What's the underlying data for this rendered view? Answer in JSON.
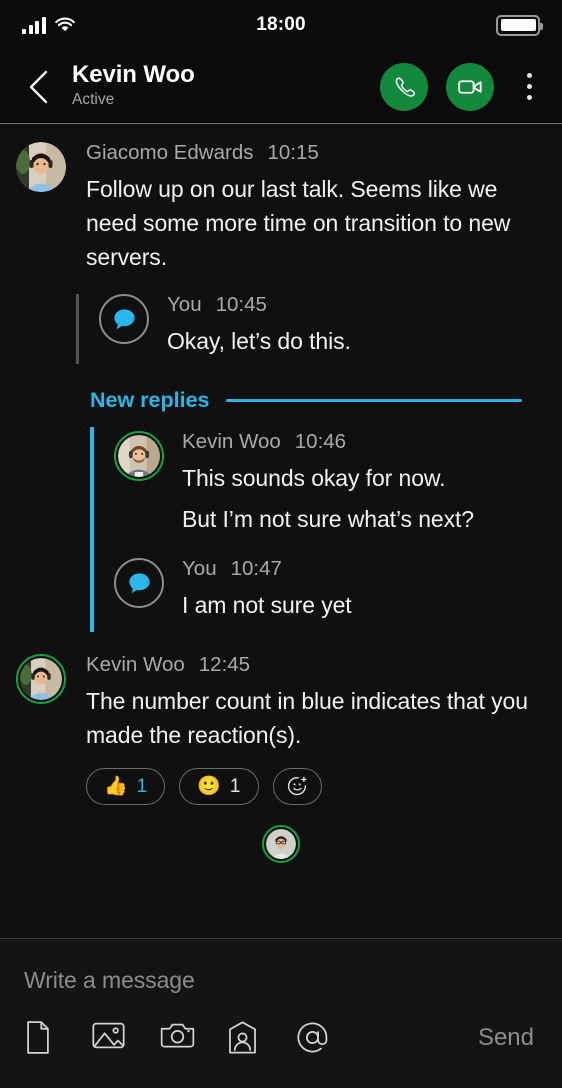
{
  "status_bar": {
    "time": "18:00",
    "signal_icon": "signal-bars-icon",
    "wifi_icon": "wifi-icon",
    "battery_icon": "battery-full-icon"
  },
  "header": {
    "back_icon": "chevron-left-icon",
    "contact_name": "Kevin Woo",
    "presence": "Active",
    "call_icon": "phone-icon",
    "video_icon": "video-camera-icon",
    "menu_icon": "kebab-menu-icon",
    "accent_green": "#12893c"
  },
  "theme": {
    "background": "#101010",
    "accent_cyan": "#29b6e8",
    "online_green": "#13a33f",
    "muted_text": "#a9a9a9",
    "body_text": "#f2f2f2"
  },
  "conversation": {
    "root_message": {
      "author": "Giacomo Edwards",
      "time": "10:15",
      "avatar_name": "avatar-giacomo-edwards",
      "text": "Follow up on our last talk. Seems like we need some more time on transition to new servers."
    },
    "old_reply": {
      "author": "You",
      "time": "10:45",
      "avatar_name": "avatar-you-speech-bubble",
      "text": "Okay, let’s do this."
    },
    "new_replies_divider": {
      "label": "New replies"
    },
    "new_replies": [
      {
        "author": "Kevin Woo",
        "time": "10:46",
        "avatar_name": "avatar-kevin-woo",
        "online": true,
        "lines": [
          "This sounds okay for now.",
          "But I’m not sure what’s next?"
        ]
      },
      {
        "author": "You",
        "time": "10:47",
        "avatar_name": "avatar-you-speech-bubble",
        "online": false,
        "lines": [
          "I am not sure yet"
        ]
      }
    ],
    "last_message": {
      "author": "Kevin Woo",
      "time": "12:45",
      "avatar_name": "avatar-kevin-woo-alt",
      "text": "The number count in blue indicates that you made the reaction(s).",
      "reactions": [
        {
          "emoji": "👍",
          "count": "1",
          "own": true,
          "name": "reaction-thumbs-up"
        },
        {
          "emoji": "🙂",
          "count": "1",
          "own": false,
          "name": "reaction-smiley"
        }
      ],
      "add_reaction_icon": "add-reaction-icon"
    },
    "read_receipt": {
      "avatar_name": "read-receipt-avatar",
      "online": true
    }
  },
  "composer": {
    "placeholder": "Write a message",
    "value": "",
    "attachments": [
      {
        "name": "attach-file-icon",
        "label": "file"
      },
      {
        "name": "attach-image-icon",
        "label": "image"
      },
      {
        "name": "camera-icon",
        "label": "camera"
      },
      {
        "name": "contact-icon",
        "label": "contact"
      },
      {
        "name": "mention-icon",
        "label": "mention"
      }
    ],
    "send_label": "Send"
  }
}
